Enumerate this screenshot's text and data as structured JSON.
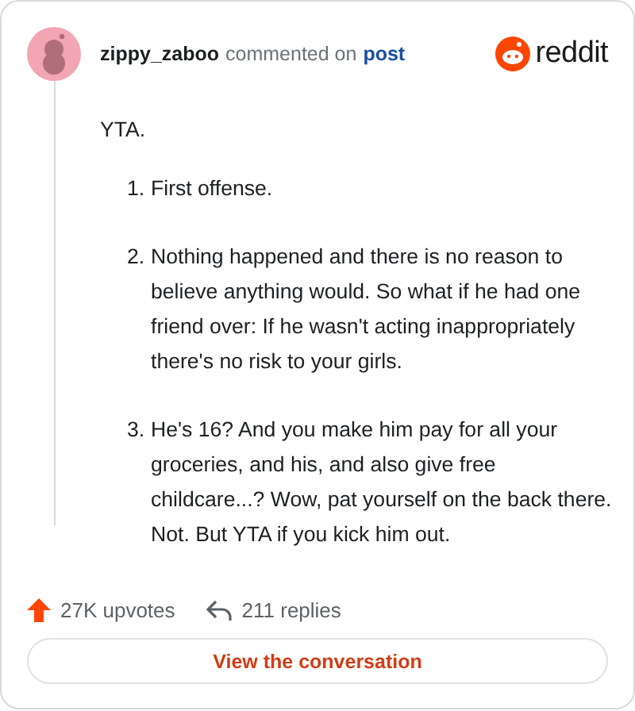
{
  "comment": {
    "author": "zippy_zaboo",
    "action": "commented on",
    "link": "post"
  },
  "brand": {
    "name": "reddit"
  },
  "body": {
    "intro": "YTA.",
    "points": [
      {
        "number": "1.",
        "text": "First offense."
      },
      {
        "number": "2.",
        "text": "Nothing happened and there is no reason to believe anything would. So what if he had one friend over: If he wasn't acting inappropriately there's no risk to your girls."
      },
      {
        "number": "3.",
        "text": "He's 16? And you make him pay for all your groceries, and his, and also give free childcare...? Wow, pat yourself on the back there. Not. But YTA if you kick him out."
      }
    ]
  },
  "stats": {
    "upvotes": "27K upvotes",
    "replies": "211 replies"
  },
  "button": "View the conversation"
}
